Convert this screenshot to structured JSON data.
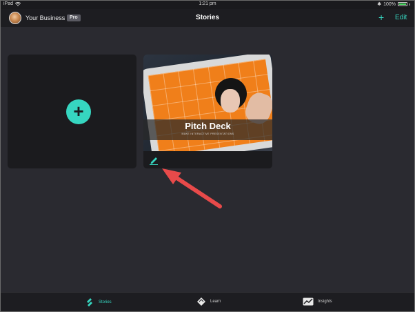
{
  "status_bar": {
    "device": "iPad",
    "time": "1:21 pm",
    "battery": "100%",
    "battery_level": 1.0
  },
  "nav": {
    "business_name": "Your Business",
    "badge": "Pro",
    "title": "Stories",
    "add_label": "+",
    "edit_label": "Edit"
  },
  "cards": {
    "new_story_symbol": "+",
    "story": {
      "title": "Pitch Deck",
      "subtitle": "MAKE INTERACTIVE PRESENTATIONS",
      "edit_icon": "pencil-icon"
    }
  },
  "annotation": {
    "arrow_color": "#e84a4a"
  },
  "tabs": [
    {
      "label": "Stories",
      "icon": "stories-icon",
      "active": true
    },
    {
      "label": "Learn",
      "icon": "learn-icon",
      "active": false
    },
    {
      "label": "Insights",
      "icon": "insights-icon",
      "active": false
    }
  ],
  "colors": {
    "accent": "#36d6c0",
    "background": "#2a2a30",
    "card": "#1b1b1e"
  }
}
